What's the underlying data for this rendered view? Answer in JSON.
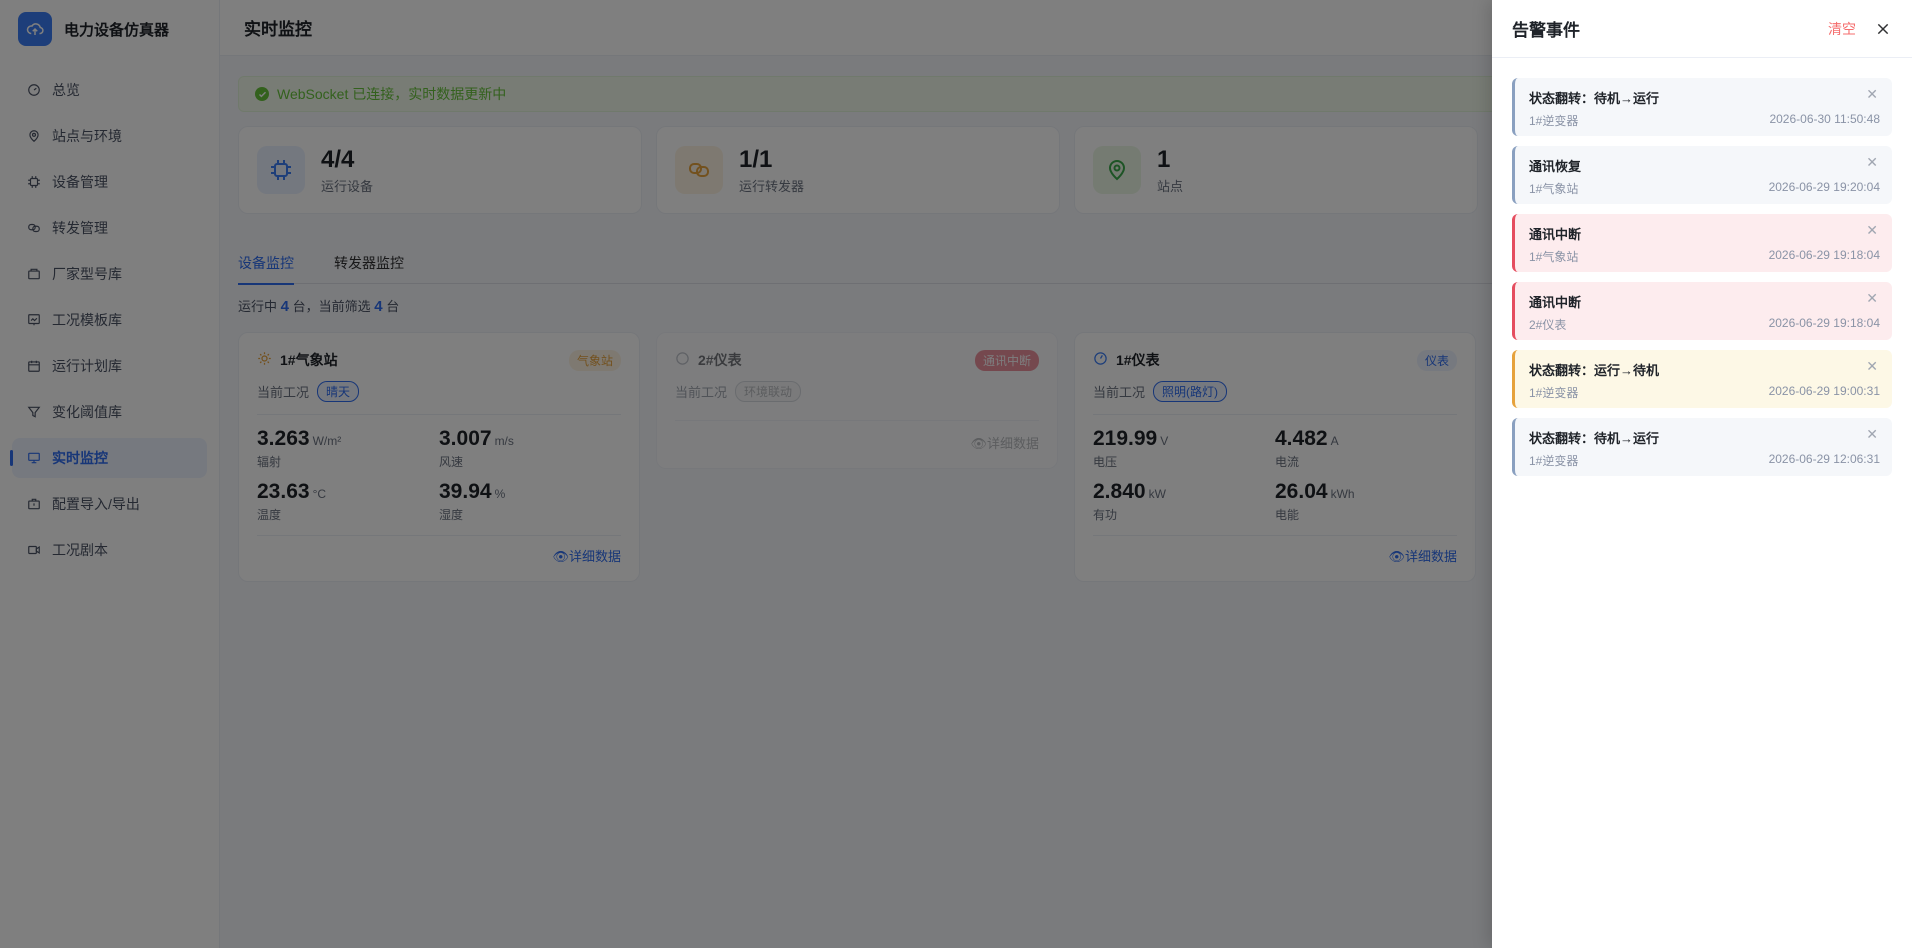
{
  "app": {
    "title": "电力设备仿真器"
  },
  "sidebar": {
    "items": [
      {
        "label": "总览",
        "icon": "dashboard-icon"
      },
      {
        "label": "站点与环境",
        "icon": "location-icon"
      },
      {
        "label": "设备管理",
        "icon": "chip-icon"
      },
      {
        "label": "转发管理",
        "icon": "link-icon"
      },
      {
        "label": "厂家型号库",
        "icon": "box-icon"
      },
      {
        "label": "工况模板库",
        "icon": "template-icon"
      },
      {
        "label": "运行计划库",
        "icon": "calendar-icon"
      },
      {
        "label": "变化阈值库",
        "icon": "filter-icon"
      },
      {
        "label": "实时监控",
        "icon": "monitor-icon",
        "active": true
      },
      {
        "label": "配置导入/导出",
        "icon": "briefcase-icon"
      },
      {
        "label": "工况剧本",
        "icon": "video-icon"
      }
    ]
  },
  "header": {
    "title": "实时监控"
  },
  "alert": {
    "text": "WebSocket 已连接，实时数据更新中"
  },
  "stats": [
    {
      "value": "4/4",
      "label": "运行设备",
      "icon": "chip-icon",
      "color": "#3b7cf5"
    },
    {
      "value": "1/1",
      "label": "运行转发器",
      "icon": "link-icon",
      "color": "#e6a23c"
    },
    {
      "value": "1",
      "label": "站点",
      "icon": "location-icon",
      "color": "#67c23a"
    }
  ],
  "tabs": [
    {
      "label": "设备监控",
      "active": true
    },
    {
      "label": "转发器监控"
    }
  ],
  "summary": {
    "prefix": "运行中",
    "running": "4",
    "mid": "台，当前筛选",
    "filtered": "4",
    "suffix": "台"
  },
  "devices": [
    {
      "name": "1#气象站",
      "icon": "sun-icon",
      "tag": "气象站",
      "cond_label": "当前工况",
      "cond": "晴天",
      "metrics": [
        {
          "value": "3.263",
          "unit": "W/m²",
          "label": "辐射"
        },
        {
          "value": "3.007",
          "unit": "m/s",
          "label": "风速"
        },
        {
          "value": "23.63",
          "unit": "°C",
          "label": "温度"
        },
        {
          "value": "39.94",
          "unit": "%",
          "label": "湿度"
        }
      ],
      "detail": "详细数据"
    },
    {
      "name": "2#仪表",
      "icon": "meter-icon",
      "tag": "通讯中断",
      "cond_label": "当前工况",
      "cond": "环境联动",
      "metrics": [],
      "detail": "详细数据"
    },
    {
      "name": "1#仪表",
      "icon": "meter-icon",
      "tag": "仪表",
      "cond_label": "当前工况",
      "cond": "照明(路灯)",
      "metrics": [
        {
          "value": "219.99",
          "unit": "V",
          "label": "电压"
        },
        {
          "value": "4.482",
          "unit": "A",
          "label": "电流"
        },
        {
          "value": "2.840",
          "unit": "kW",
          "label": "有功"
        },
        {
          "value": "26.04",
          "unit": "kWh",
          "label": "电能"
        }
      ],
      "detail": "详细数据"
    }
  ],
  "drawer": {
    "title": "告警事件",
    "clear": "清空",
    "alarms": [
      {
        "title": "状态翻转：待机→运行",
        "device": "1#逆变器",
        "time": "2026-06-30 11:50:48",
        "level": "info"
      },
      {
        "title": "通讯恢复",
        "device": "1#气象站",
        "time": "2026-06-29 19:20:04",
        "level": "info"
      },
      {
        "title": "通讯中断",
        "device": "1#气象站",
        "time": "2026-06-29 19:18:04",
        "level": "danger"
      },
      {
        "title": "通讯中断",
        "device": "2#仪表",
        "time": "2026-06-29 19:18:04",
        "level": "danger"
      },
      {
        "title": "状态翻转：运行→待机",
        "device": "1#逆变器",
        "time": "2026-06-29 19:00:31",
        "level": "warn"
      },
      {
        "title": "状态翻转：待机→运行",
        "device": "1#逆变器",
        "time": "2026-06-29 12:06:31",
        "level": "info"
      }
    ]
  }
}
